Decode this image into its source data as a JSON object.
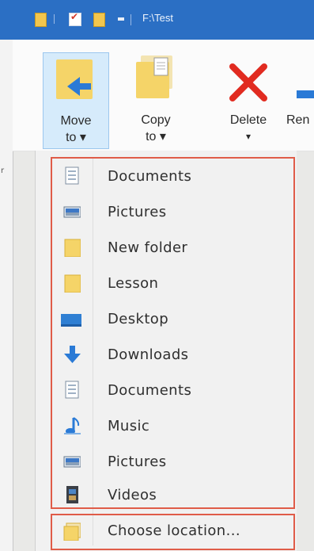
{
  "window": {
    "title": "F:\\Test"
  },
  "ribbon": {
    "move_to": {
      "line1": "Move",
      "line2": "to ▾"
    },
    "copy_to": {
      "line1": "Copy",
      "line2": "to ▾"
    },
    "delete": {
      "line1": "Delete",
      "line2": "▾"
    },
    "rename": {
      "partial": "Ren"
    }
  },
  "left_strip": {
    "char": "r"
  },
  "menu": {
    "items": [
      {
        "label": "Documents",
        "icon": "documents-icon"
      },
      {
        "label": "Pictures",
        "icon": "pictures-icon"
      },
      {
        "label": "New folder",
        "icon": "folder-icon"
      },
      {
        "label": "Lesson",
        "icon": "folder-icon"
      },
      {
        "label": "Desktop",
        "icon": "desktop-icon"
      },
      {
        "label": "Downloads",
        "icon": "downloads-icon"
      },
      {
        "label": "Documents",
        "icon": "documents-icon"
      },
      {
        "label": "Music",
        "icon": "music-icon"
      },
      {
        "label": "Pictures",
        "icon": "pictures-icon"
      },
      {
        "label": "Videos",
        "icon": "videos-icon"
      }
    ],
    "choose_location": "Choose location..."
  },
  "colors": {
    "titlebar": "#2b6fc4",
    "highlight_border": "#e05c48",
    "active_button_bg": "#d6ebfb"
  }
}
